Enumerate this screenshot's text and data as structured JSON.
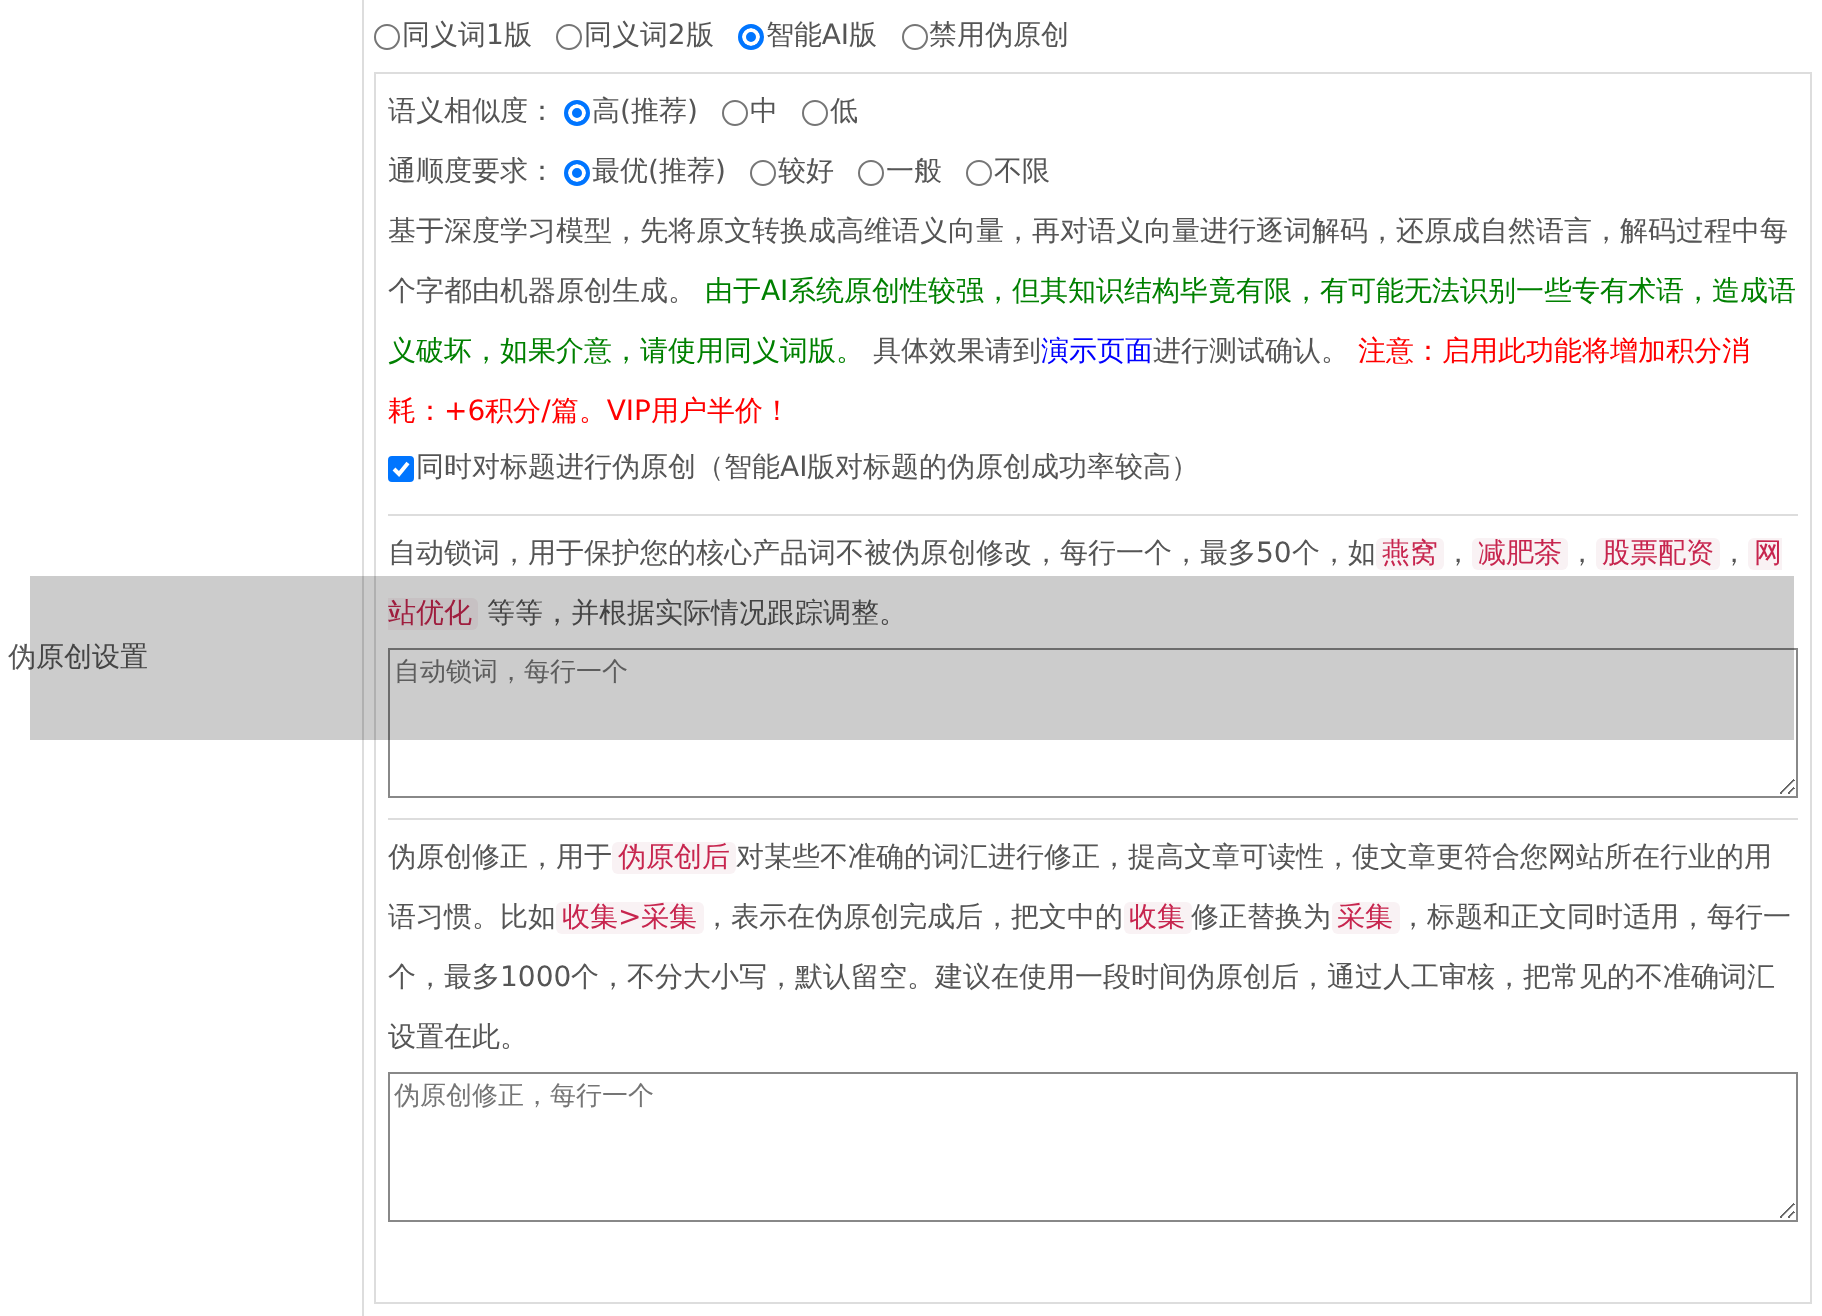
{
  "section_label": "伪原创设置",
  "modes": [
    {
      "label": "同义词1版",
      "selected": false
    },
    {
      "label": "同义词2版",
      "selected": false
    },
    {
      "label": "智能AI版",
      "selected": true
    },
    {
      "label": "禁用伪原创",
      "selected": false
    }
  ],
  "similarity": {
    "label": "语义相似度：",
    "options": [
      {
        "label": "高(推荐)",
        "selected": true
      },
      {
        "label": "中",
        "selected": false
      },
      {
        "label": "低",
        "selected": false
      }
    ]
  },
  "fluency": {
    "label": "通顺度要求：",
    "options": [
      {
        "label": "最优(推荐)",
        "selected": true
      },
      {
        "label": "较好",
        "selected": false
      },
      {
        "label": "一般",
        "selected": false
      },
      {
        "label": "不限",
        "selected": false
      }
    ]
  },
  "ai_description": [
    {
      "kind": "plain",
      "text": "基于深度学习模型，先将原文转换成高维语义向量，再对语义向量进行逐词解码，还原成自然语言，解码过程中每个字都由机器原创生成。 "
    },
    {
      "kind": "notice",
      "text": "由于AI系统原创性较强，但其知识结构毕竟有限，有可能无法识别一些专有术语，造成语义破坏，如果介意，请使用同义词版。"
    },
    {
      "kind": "plain",
      "text": " 具体效果请到"
    },
    {
      "kind": "link",
      "text": "演示页面"
    },
    {
      "kind": "plain",
      "text": "进行测试确认。 "
    },
    {
      "kind": "warning",
      "text": "注意：启用此功能将增加积分消耗：+6积分/篇。VIP用户半价！"
    }
  ],
  "title_option": {
    "label": "同时对标题进行伪原创（智能AI版对标题的伪原创成功率较高）",
    "checked": true
  },
  "lock_words": {
    "description": [
      {
        "kind": "plain",
        "text": "自动锁词，用于保护您的核心产品词不被伪原创修改，每行一个，最多50个，如"
      },
      {
        "kind": "code",
        "text": "燕窝"
      },
      {
        "kind": "plain",
        "text": "，"
      },
      {
        "kind": "code",
        "text": "减肥茶"
      },
      {
        "kind": "plain",
        "text": "，"
      },
      {
        "kind": "code",
        "text": "股票配资"
      },
      {
        "kind": "plain",
        "text": "，"
      },
      {
        "kind": "code",
        "text": "网站优化"
      },
      {
        "kind": "plain",
        "text": " 等等，并根据实际情况跟踪调整。"
      }
    ],
    "placeholder": "自动锁词，每行一个"
  },
  "correction": {
    "description": [
      {
        "kind": "plain",
        "text": "伪原创修正，用于"
      },
      {
        "kind": "code",
        "text": "伪原创后"
      },
      {
        "kind": "plain",
        "text": "对某些不准确的词汇进行修正，提高文章可读性，使文章更符合您网站所在行业的用语习惯。比如"
      },
      {
        "kind": "code",
        "text": "收集>采集"
      },
      {
        "kind": "plain",
        "text": "，表示在伪原创完成后，把文中的"
      },
      {
        "kind": "code",
        "text": "收集"
      },
      {
        "kind": "plain",
        "text": "修正替换为"
      },
      {
        "kind": "code",
        "text": "采集"
      },
      {
        "kind": "plain",
        "text": "，标题和正文同时适用，每行一个，最多1000个，不分大小写，默认留空。建议在使用一段时间伪原创后，通过人工审核，把常见的不准确词汇设置在此。"
      }
    ],
    "placeholder": "伪原创修正，每行一个"
  }
}
